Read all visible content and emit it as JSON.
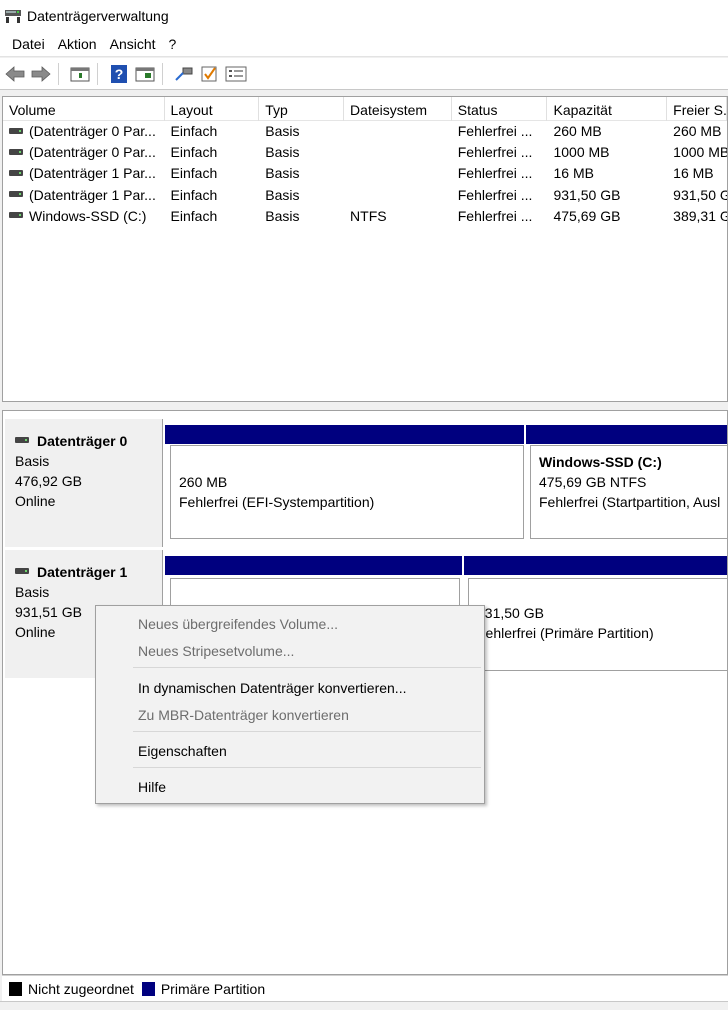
{
  "window": {
    "title": "Datenträgerverwaltung"
  },
  "menubar": {
    "items": [
      "Datei",
      "Aktion",
      "Ansicht",
      "?"
    ]
  },
  "toolbar": {
    "icons": [
      "back-arrow-icon",
      "forward-arrow-icon",
      "list-view-icon",
      "help-icon",
      "properties-icon",
      "connect-icon",
      "checkbox-icon",
      "settings-list-icon"
    ]
  },
  "volume_list": {
    "columns": [
      "Volume",
      "Layout",
      "Typ",
      "Dateisystem",
      "Status",
      "Kapazität",
      "Freier S..."
    ],
    "rows": [
      [
        "(Datenträger 0 Par...",
        "Einfach",
        "Basis",
        "",
        "Fehlerfrei ...",
        "260 MB",
        "260 MB"
      ],
      [
        "(Datenträger 0 Par...",
        "Einfach",
        "Basis",
        "",
        "Fehlerfrei ...",
        "1000 MB",
        "1000 MB"
      ],
      [
        "(Datenträger 1 Par...",
        "Einfach",
        "Basis",
        "",
        "Fehlerfrei ...",
        "16 MB",
        "16 MB"
      ],
      [
        "(Datenträger 1 Par...",
        "Einfach",
        "Basis",
        "",
        "Fehlerfrei ...",
        "931,50 GB",
        "931,50 G"
      ],
      [
        "Windows-SSD (C:)",
        "Einfach",
        "Basis",
        "NTFS",
        "Fehlerfrei ...",
        "475,69 GB",
        "389,31 G"
      ]
    ]
  },
  "disks": [
    {
      "name": "Datenträger 0",
      "type": "Basis",
      "size": "476,92 GB",
      "state": "Online",
      "partitions": [
        {
          "name": "",
          "size": "260 MB",
          "status": "Fehlerfrei (EFI-Systempartition)"
        },
        {
          "name": "Windows-SSD  (C:)",
          "size": "475,69 GB NTFS",
          "status": "Fehlerfrei (Startpartition, Ausl"
        }
      ]
    },
    {
      "name": "Datenträger 1",
      "type": "Basis",
      "size": "931,51 GB",
      "state": "Online",
      "partitions": [
        {
          "name": "",
          "size": "",
          "status": ""
        },
        {
          "name": "",
          "size": "931,50 GB",
          "status": "Fehlerfrei (Primäre Partition)"
        }
      ]
    }
  ],
  "context_menu": {
    "items": [
      {
        "label": "Neues übergreifendes Volume...",
        "enabled": false
      },
      {
        "label": "Neues Stripesetvolume...",
        "enabled": false
      },
      {
        "label": "In dynamischen Datenträger konvertieren...",
        "enabled": true
      },
      {
        "label": "Zu MBR-Datenträger konvertieren",
        "enabled": false
      },
      {
        "label": "Eigenschaften",
        "enabled": true
      },
      {
        "label": "Hilfe",
        "enabled": true
      }
    ]
  },
  "legend": {
    "items": [
      {
        "label": "Nicht zugeordnet",
        "color": "#000000"
      },
      {
        "label": "Primäre Partition",
        "color": "#00007f"
      }
    ]
  },
  "colors": {
    "primary_partition": "#00007f",
    "unallocated": "#000000",
    "disabled_text": "#6d6d6d"
  }
}
